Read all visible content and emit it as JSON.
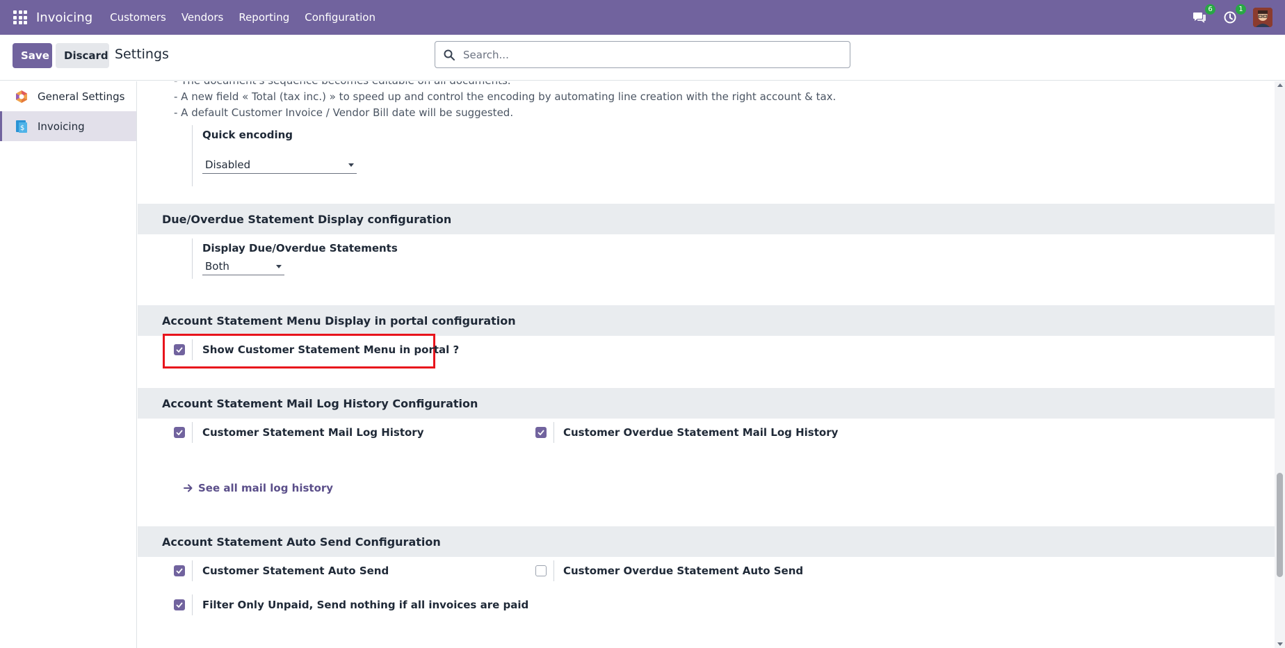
{
  "navbar": {
    "app_name": "Invoicing",
    "menu": [
      "Customers",
      "Vendors",
      "Reporting",
      "Configuration"
    ],
    "messages_count": "6",
    "activities_count": "1",
    "color": "#71639e"
  },
  "control_panel": {
    "save_label": "Save",
    "discard_label": "Discard",
    "title": "Settings",
    "search_placeholder": "Search..."
  },
  "sidebar": {
    "items": [
      {
        "label": "General Settings",
        "icon": "odoo-logo-icon",
        "active": false
      },
      {
        "label": "Invoicing",
        "icon": "invoicing-app-icon",
        "active": true
      }
    ]
  },
  "content": {
    "quick_encoding_desc": [
      "- The document's sequence becomes editable on all documents.",
      "- A new field « Total (tax inc.) » to speed up and control the encoding by automating line creation with the right account & tax.",
      "- A default Customer Invoice / Vendor Bill date will be suggested."
    ],
    "quick_encoding_label": "Quick encoding",
    "quick_encoding_value": "Disabled",
    "due_section": {
      "title": "Due/Overdue Statement Display configuration",
      "field_label": "Display Due/Overdue Statements",
      "field_value": "Both"
    },
    "portal_section": {
      "title": "Account Statement Menu Display in portal configuration",
      "show_menu_label": "Show Customer Statement Menu in portal ?",
      "show_menu_checked": true
    },
    "mail_log_section": {
      "title": "Account Statement Mail Log History Configuration",
      "customer_log_label": "Customer Statement Mail Log History",
      "customer_log_checked": true,
      "overdue_log_label": "Customer Overdue Statement Mail Log History",
      "overdue_log_checked": true,
      "see_all_link": "See all mail log history"
    },
    "auto_send_section": {
      "title": "Account Statement Auto Send Configuration",
      "customer_auto_label": "Customer Statement Auto Send",
      "customer_auto_checked": true,
      "overdue_auto_label": "Customer Overdue Statement Auto Send",
      "overdue_auto_checked": false,
      "filter_unpaid_label": "Filter Only Unpaid, Send nothing if all invoices are paid",
      "filter_unpaid_checked": true
    }
  },
  "colors": {
    "accent": "#71639e",
    "highlight": "#e8141c",
    "section_bg": "#e9ecef"
  }
}
